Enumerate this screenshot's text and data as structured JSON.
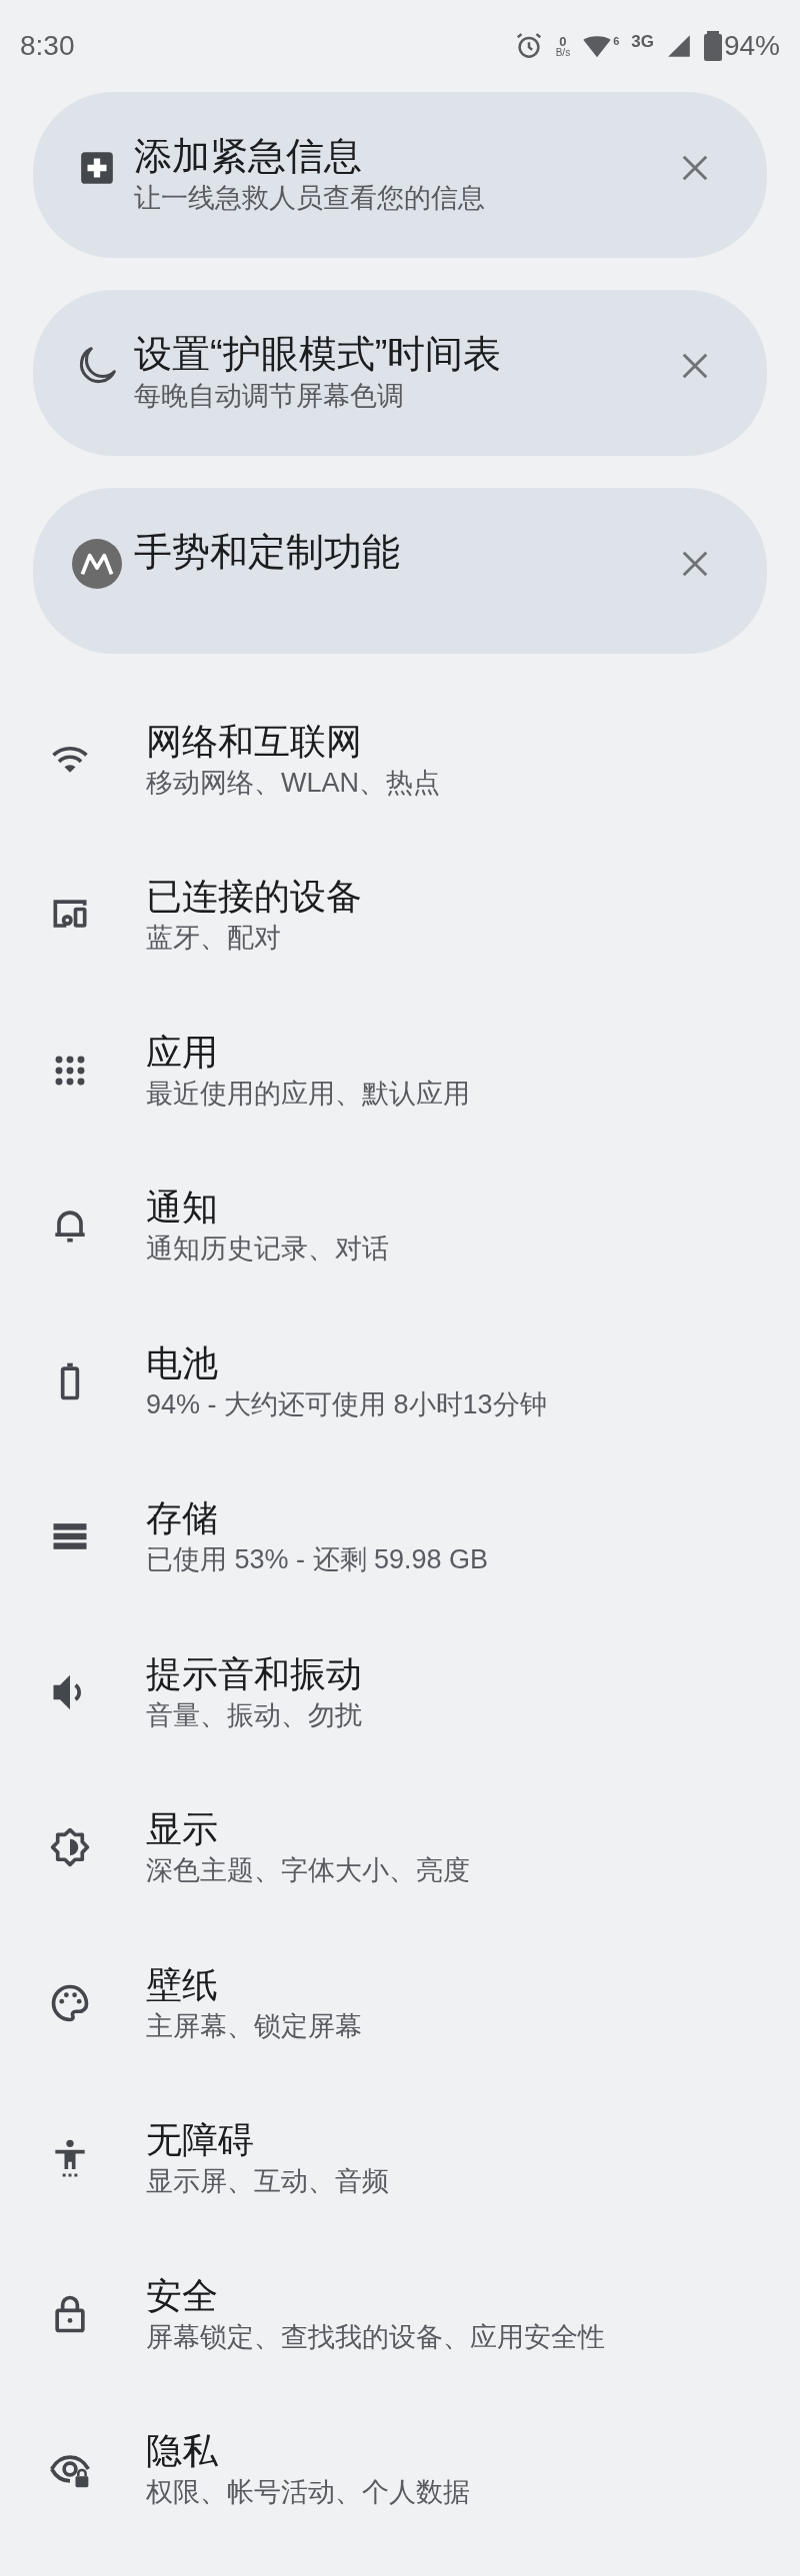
{
  "status_bar": {
    "time": "8:30",
    "net_speed_value": "0",
    "net_speed_unit": "B/s",
    "wifi_badge": "6",
    "network_type": "3G",
    "battery": "94%"
  },
  "suggestion_cards": [
    {
      "title": "添加紧急信息",
      "subtitle": "让一线急救人员查看您的信息"
    },
    {
      "title": "设置“护眼模式”时间表",
      "subtitle": "每晚自动调节屏幕色调"
    },
    {
      "title": "手势和定制功能"
    }
  ],
  "settings_items": [
    {
      "title": "网络和互联网",
      "subtitle": "移动网络、WLAN、热点"
    },
    {
      "title": "已连接的设备",
      "subtitle": "蓝牙、配对"
    },
    {
      "title": "应用",
      "subtitle": "最近使用的应用、默认应用"
    },
    {
      "title": "通知",
      "subtitle": "通知历史记录、对话"
    },
    {
      "title": "电池",
      "subtitle": "94% - 大约还可使用 8小时13分钟"
    },
    {
      "title": "存储",
      "subtitle": "已使用 53% - 还剩 59.98 GB"
    },
    {
      "title": "提示音和振动",
      "subtitle": "音量、振动、勿扰"
    },
    {
      "title": "显示",
      "subtitle": "深色主题、字体大小、亮度"
    },
    {
      "title": "壁纸",
      "subtitle": "主屏幕、锁定屏幕"
    },
    {
      "title": "无障碍",
      "subtitle": "显示屏、互动、音频"
    },
    {
      "title": "安全",
      "subtitle": "屏幕锁定、查找我的设备、应用安全性"
    },
    {
      "title": "隐私",
      "subtitle": "权限、帐号活动、个人数据"
    }
  ]
}
